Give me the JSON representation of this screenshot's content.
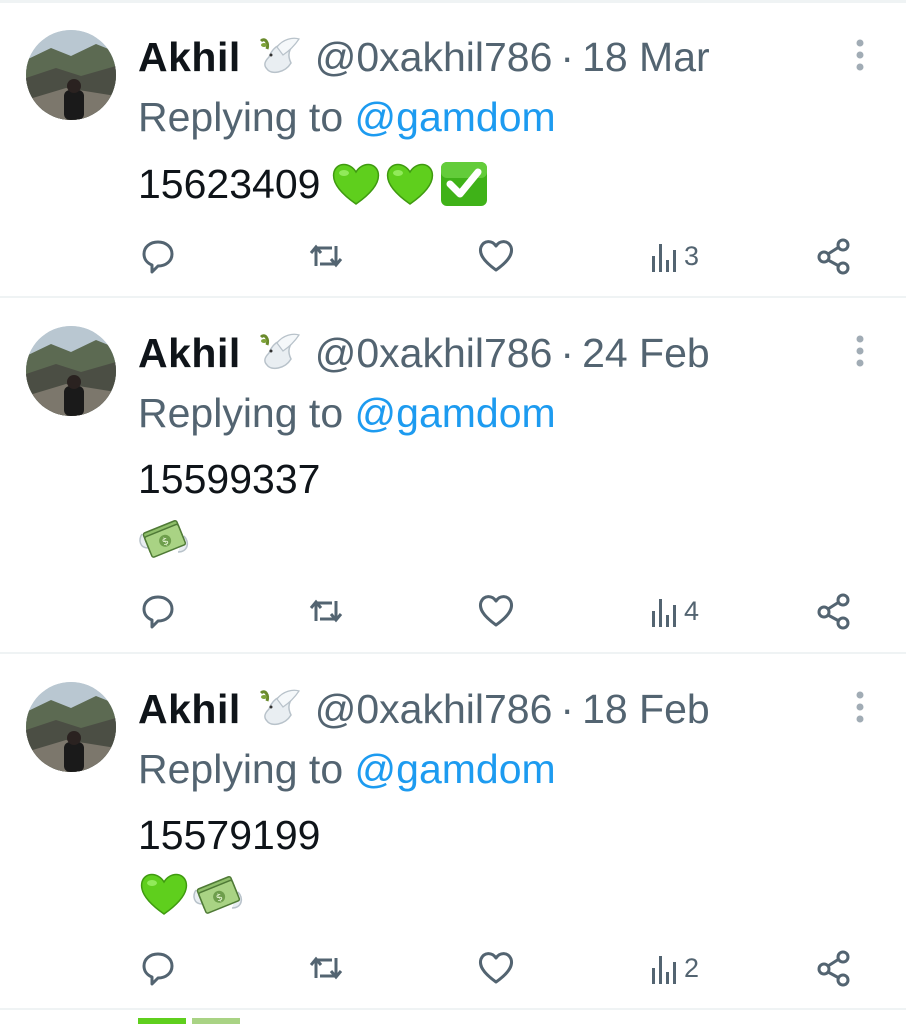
{
  "colors": {
    "text": "#0f1419",
    "secondary": "#536471",
    "link": "#1d9bf0",
    "divider": "#eff3f4",
    "heart_green": "#5fcf1d",
    "check_green": "#3fb218"
  },
  "tweets": [
    {
      "name": "Akhil",
      "badge_icon": "dove-emoji",
      "handle": "@0xakhil786",
      "separator": "·",
      "date": "18 Mar",
      "reply_prefix": "Replying to ",
      "reply_to": "@gamdom",
      "body": "15623409",
      "emojis": [
        "green-heart",
        "green-heart",
        "check-mark-button"
      ],
      "views": "3"
    },
    {
      "name": "Akhil",
      "badge_icon": "dove-emoji",
      "handle": "@0xakhil786",
      "separator": "·",
      "date": "24 Feb",
      "reply_prefix": "Replying to ",
      "reply_to": "@gamdom",
      "body": "15599337",
      "emojis": [
        "money-with-wings"
      ],
      "views": "4"
    },
    {
      "name": "Akhil",
      "badge_icon": "dove-emoji",
      "handle": "@0xakhil786",
      "separator": "·",
      "date": "18 Feb",
      "reply_prefix": "Replying to ",
      "reply_to": "@gamdom",
      "body": "15579199",
      "emojis": [
        "green-heart",
        "money-with-wings"
      ],
      "views": "2"
    }
  ]
}
